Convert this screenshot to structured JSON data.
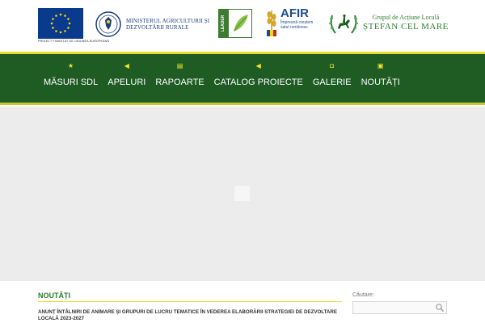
{
  "header": {
    "eu_caption": "PROIECT FINANȚAT DE UNIUNEA EUROPEANĂ",
    "ministry": {
      "line1": "MINISTERUL AGRICULTURII ȘI",
      "line2": "DEZVOLTĂRII RURALE"
    },
    "leader_label": "LEADER",
    "afir": {
      "title": "AFIR",
      "sub1": "Împreună creștem",
      "sub2": "satul românesc"
    },
    "gal": {
      "line1": "Grupul de Acțiune Locală",
      "line2": "ȘTEFAN CEL MARE"
    }
  },
  "nav": {
    "items": [
      {
        "label": "MĂSURI SDL",
        "icon": "star-icon"
      },
      {
        "label": "APELURI",
        "icon": "megaphone-icon"
      },
      {
        "label": "RAPOARTE",
        "icon": "document-icon"
      },
      {
        "label": "CATALOG PROIECTE",
        "icon": "megaphone-icon"
      },
      {
        "label": "GALERIE",
        "icon": "camera-icon"
      },
      {
        "label": "NOUTĂȚI",
        "icon": "newspaper-icon"
      }
    ]
  },
  "news": {
    "heading": "NOUTĂȚI",
    "item_title": "ANUNȚ ÎNTÂLNIRI DE ANIMARE ȘI GRUPURI DE LUCRU TEMATICE ÎN VEDEREA ELABORĂRII STRATEGIEI DE DEZVOLTARE LOCALĂ 2023-2027"
  },
  "search": {
    "label": "Căutare:",
    "value": ""
  },
  "colors": {
    "nav_green": "#1f5c24",
    "accent_yellow": "#e6dd2c",
    "eu_blue": "#0a3a8c",
    "title_green": "#2e7d32"
  }
}
